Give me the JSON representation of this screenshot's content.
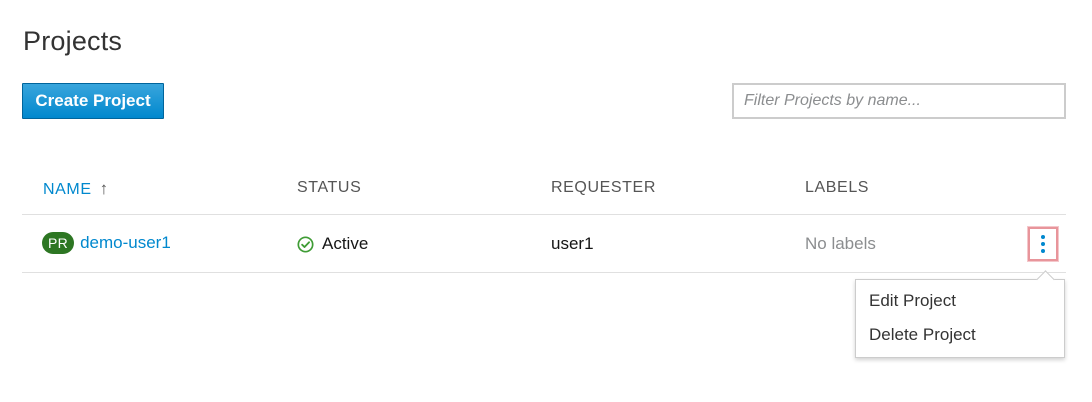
{
  "page": {
    "title": "Projects"
  },
  "toolbar": {
    "create_label": "Create Project",
    "filter_placeholder": "Filter Projects by name..."
  },
  "table": {
    "headers": {
      "name": "NAME",
      "status": "STATUS",
      "requester": "REQUESTER",
      "labels": "LABELS"
    },
    "sort": "ascending",
    "rows": [
      {
        "badge": "PR",
        "name": "demo-user1",
        "status": "Active",
        "requester": "user1",
        "labels": "No labels"
      }
    ]
  },
  "row_menu": {
    "items": [
      "Edit Project",
      "Delete Project"
    ]
  },
  "icons": {
    "sort": "sort-ascending-icon",
    "status": "check-circle-icon",
    "actions": "kebab-icon"
  },
  "colors": {
    "accent": "#0088ce",
    "badge": "#2d7623",
    "status_ok": "#3f9c35",
    "focus_outline": "#e8959b"
  }
}
